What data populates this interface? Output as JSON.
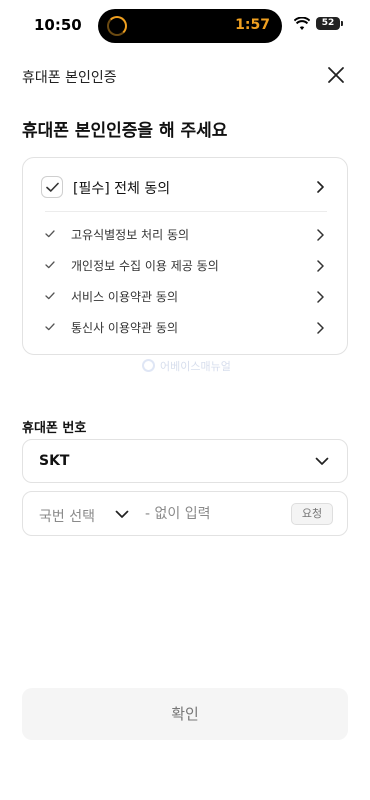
{
  "status_bar": {
    "time": "10:50",
    "timer": "1:57",
    "battery": "52"
  },
  "header": {
    "title": "휴대폰 본인인증"
  },
  "main": {
    "title": "휴대폰 본인인증을 해 주세요"
  },
  "agreement": {
    "all_label": "[필수] 전체 동의",
    "all_checked": true,
    "items": [
      {
        "label": "고유식별정보 처리 동의"
      },
      {
        "label": "개인정보 수집 이용 제공 동의"
      },
      {
        "label": "서비스 이용약관 동의"
      },
      {
        "label": "통신사 이용약관 동의"
      }
    ]
  },
  "watermark": {
    "text": "어베이스매뉴얼"
  },
  "phone": {
    "label": "휴대폰 번호",
    "carrier_value": "SKT",
    "prefix_placeholder": "국번 선택",
    "number_placeholder": "- 없이 입력",
    "request_label": "요청"
  },
  "confirm_label": "확인",
  "colors": {
    "accent_check": "#333333",
    "border": "#e2e2e2",
    "disabled_button": "#f5f5f5"
  }
}
